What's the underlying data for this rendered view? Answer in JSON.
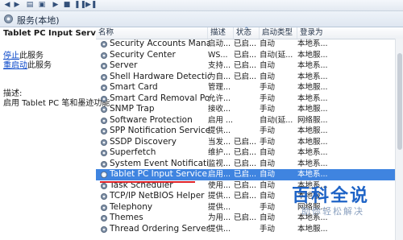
{
  "window": {
    "title": "服务(本地)"
  },
  "toolbar": {
    "buttons": [
      "back",
      "forward",
      "play",
      "stop",
      "pause",
      "resume"
    ]
  },
  "left_pane": {
    "title": "Tablet PC Input Service",
    "stop_link": "停止",
    "stop_suffix": "此服务",
    "restart_link": "重启动",
    "restart_suffix": "此服务",
    "desc_label": "描述:",
    "desc_text": "启用 Tablet PC 笔和墨迹功能"
  },
  "columns": {
    "name": "名称",
    "desc": "描述",
    "status": "状态",
    "startup": "启动类型",
    "logon": "登录为"
  },
  "services": [
    {
      "name": "Security Accounts Manager",
      "desc": "启动...",
      "status": "已启...",
      "startup": "自动",
      "logon": "本地系..."
    },
    {
      "name": "Security Center",
      "desc": "WS...",
      "status": "已启...",
      "startup": "自动(延...",
      "logon": "本地服..."
    },
    {
      "name": "Server",
      "desc": "支持...",
      "status": "已启...",
      "startup": "自动",
      "logon": "本地系..."
    },
    {
      "name": "Shell Hardware Detection",
      "desc": "为自...",
      "status": "已启...",
      "startup": "自动",
      "logon": "本地系..."
    },
    {
      "name": "Smart Card",
      "desc": "管理...",
      "status": "",
      "startup": "手动",
      "logon": "本地服..."
    },
    {
      "name": "Smart Card Removal Policy",
      "desc": "允许...",
      "status": "",
      "startup": "手动",
      "logon": "本地系..."
    },
    {
      "name": "SNMP Trap",
      "desc": "接收...",
      "status": "",
      "startup": "手动",
      "logon": "本地服..."
    },
    {
      "name": "Software Protection",
      "desc": "启用 ...",
      "status": "",
      "startup": "自动(延...",
      "logon": "网络服..."
    },
    {
      "name": "SPP Notification Service",
      "desc": "提供...",
      "status": "",
      "startup": "手动",
      "logon": "本地服..."
    },
    {
      "name": "SSDP Discovery",
      "desc": "当发...",
      "status": "已启...",
      "startup": "手动",
      "logon": "本地服..."
    },
    {
      "name": "Superfetch",
      "desc": "维护...",
      "status": "已启...",
      "startup": "自动",
      "logon": "本地系..."
    },
    {
      "name": "System Event Notification S...",
      "desc": "监视...",
      "status": "已启...",
      "startup": "自动",
      "logon": "本地系..."
    },
    {
      "name": "Tablet PC Input Service",
      "desc": "启用...",
      "status": "已启...",
      "startup": "自动",
      "logon": "本地系...",
      "selected": true
    },
    {
      "name": "Task Scheduler",
      "desc": "使用...",
      "status": "已启...",
      "startup": "自动",
      "logon": "本地系..."
    },
    {
      "name": "TCP/IP NetBIOS Helper",
      "desc": "提供...",
      "status": "已启...",
      "startup": "自动",
      "logon": "本地服..."
    },
    {
      "name": "Telephony",
      "desc": "提供...",
      "status": "",
      "startup": "手动",
      "logon": "网络服..."
    },
    {
      "name": "Themes",
      "desc": "为用...",
      "status": "已启...",
      "startup": "自动",
      "logon": "本地系..."
    },
    {
      "name": "Thread Ordering Server",
      "desc": "提供...",
      "status": "",
      "startup": "手动",
      "logon": "本地服..."
    }
  ],
  "watermark": {
    "logo": "百科全说",
    "sub": "助你轻松解决"
  },
  "colors": {
    "selected_bg": "#3f84e0",
    "underline": "#e0242a",
    "link": "#0645c8"
  }
}
